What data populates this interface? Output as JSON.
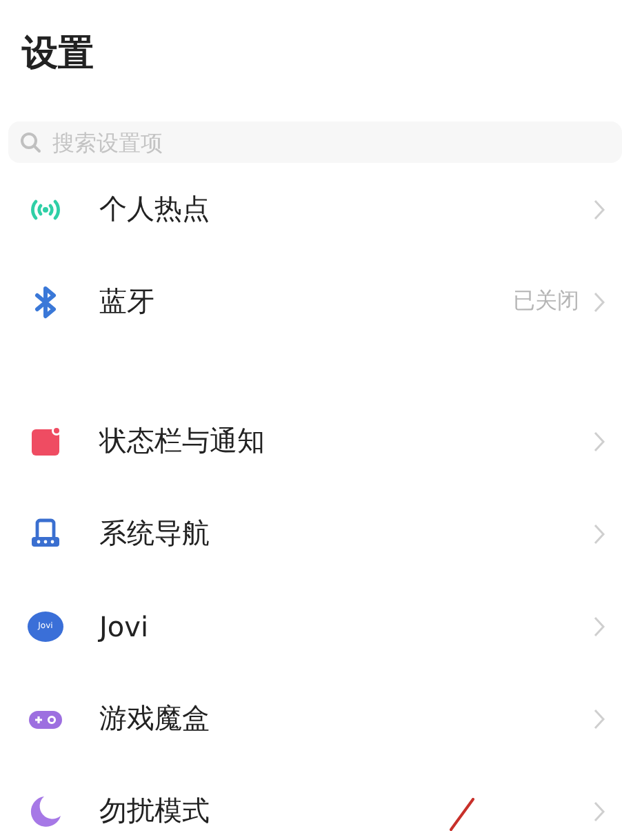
{
  "title": "设置",
  "search": {
    "placeholder": "搜索设置项"
  },
  "groups": [
    {
      "items": [
        {
          "kind": "hotspot",
          "label": "个人热点"
        },
        {
          "kind": "bluetooth",
          "label": "蓝牙",
          "value": "已关闭"
        }
      ]
    },
    {
      "items": [
        {
          "kind": "notification",
          "label": "状态栏与通知"
        },
        {
          "kind": "navigation",
          "label": "系统导航"
        },
        {
          "kind": "assistant",
          "label": "Jovi",
          "icon_text": "Jovi"
        },
        {
          "kind": "gamepad",
          "label": "游戏魔盒"
        },
        {
          "kind": "moon",
          "label": "勿扰模式"
        }
      ]
    }
  ]
}
